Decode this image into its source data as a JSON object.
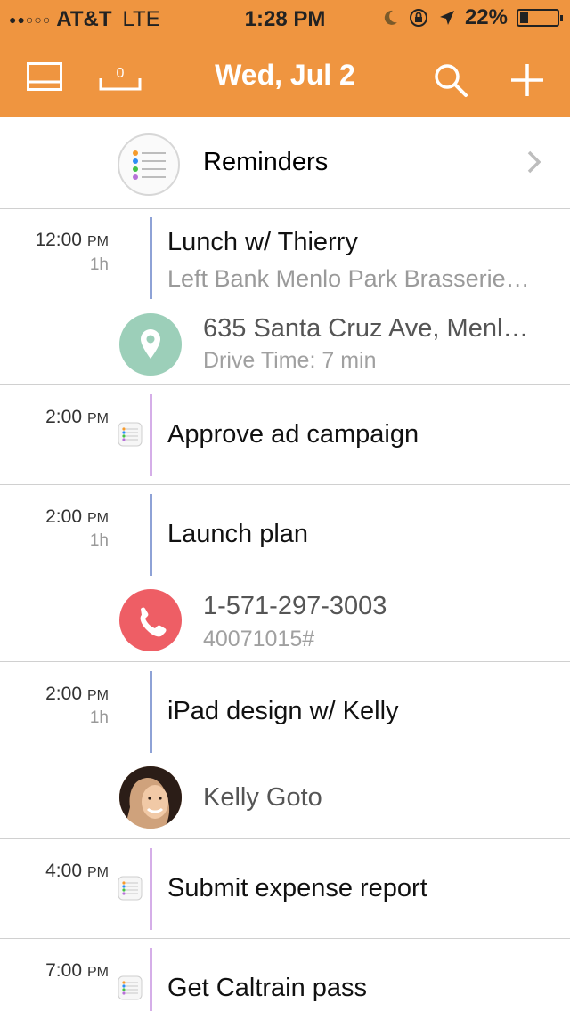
{
  "status_bar": {
    "signal": "●●○○○",
    "carrier": "AT&T",
    "network": "LTE",
    "time": "1:28 PM",
    "battery": "22%",
    "battery_level": 0.22
  },
  "nav": {
    "title": "Wed, Jul 2",
    "inbox_count": "0",
    "accent_color": "#ef9540"
  },
  "reminders": {
    "label": "Reminders"
  },
  "events": [
    {
      "time": "12:00",
      "ampm": "PM",
      "duration": "1h",
      "title": "Lunch w/ Thierry",
      "subtitle": "Left Bank Menlo Park Brasserie…",
      "color": "#8ea2d6",
      "detail": {
        "icon": "location-pin-icon",
        "color": "#9ccfb9",
        "main": "635 Santa Cruz Ave, Menl…",
        "sub": "Drive Time: 7 min"
      }
    },
    {
      "time": "2:00",
      "ampm": "PM",
      "title": "Approve ad campaign",
      "color": "#d5aee8",
      "icon": "reminder-list-icon"
    },
    {
      "time": "2:00",
      "ampm": "PM",
      "duration": "1h",
      "title": "Launch plan",
      "color": "#8ea2d6",
      "detail": {
        "icon": "phone-icon",
        "color": "#ee5e65",
        "main": "1-571-297-3003",
        "sub": "40071015#"
      }
    },
    {
      "time": "2:00",
      "ampm": "PM",
      "duration": "1h",
      "title": "iPad design w/ Kelly",
      "color": "#8ea2d6",
      "detail": {
        "icon": "avatar",
        "main": "Kelly Goto"
      }
    },
    {
      "time": "4:00",
      "ampm": "PM",
      "title": "Submit expense report",
      "color": "#d5aee8",
      "icon": "reminder-list-icon"
    },
    {
      "time": "7:00",
      "ampm": "PM",
      "title": "Get Caltrain pass",
      "color": "#d5aee8",
      "icon": "reminder-list-icon"
    }
  ]
}
